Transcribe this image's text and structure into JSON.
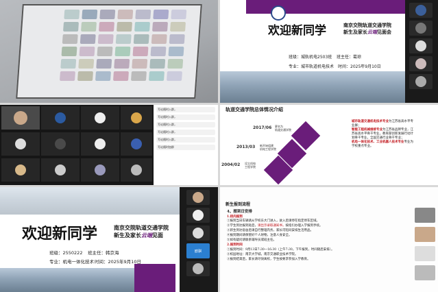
{
  "panel_slide": {
    "welcome": "欢迎新同学",
    "school_line1": "南京交院轨道交通学院",
    "school_line2_pre": "新生及家长",
    "school_line2_cloud": "云端",
    "school_line2_post": "见面会",
    "class_label": "班级：城轨机电2503班",
    "teacher_label": "班主任：葛琼",
    "major_label": "专业：城市轨道机电技术",
    "time_label": "时间：2025年9月10日"
  },
  "grid": {
    "names": [
      "欧骐",
      "欧骐",
      "欧骐",
      "欧骐",
      "老师",
      "学生",
      "家长"
    ],
    "chat": [
      "写论随时入群，",
      "写论随时入群，",
      "写论随时入群，",
      "写论随时入群，",
      "写论随时入群，",
      "写论随时加群"
    ]
  },
  "timeline": {
    "title": "轨道交通学院总体情况介绍",
    "years": [
      "2017/06",
      "2013/03",
      "2004/02"
    ],
    "boxes": [
      "更名为\n轨道交通学院",
      "新开始组建\n机电工程学院",
      "设立机电\n工程学院"
    ],
    "right_items": [
      "城市轨道交通机电技术专业",
      "智能工程机械维修专业",
      "机电一体化技术、工业机器人技术专业"
    ],
    "right_text": [
      "为江苏省高水平专业群；",
      "为江苏省品牌专业，江苏省高水平骨干专业，教育部创新发展行动计划骨干专业，全国交通行业骨干专业；",
      "专业为学校重点专业。"
    ]
  },
  "bottom_slide": {
    "welcome": "欢迎新同学",
    "school_line1": "南京交院轨道交通学院",
    "school_line2_pre": "新生及家长",
    "school_line2_cloud": "云端",
    "school_line2_post": "见面",
    "class_label": "班级：2550222",
    "teacher_label": "班主任：韩京海",
    "major_label": "专业：机电一体化技术",
    "time_label": "时间：2025年9月10日",
    "tile_label": "欧骐"
  },
  "doc": {
    "heading": "新生报到流程",
    "section": "4、报到日安排",
    "sub1": "1.校内报到",
    "line1": "①报到当日车辆请从学校东大门进入，驶入后请停在指定停车区域。",
    "line2_pre": "②学生到达报到处后，",
    "line2_red": "请出示录取通知书，",
    "line2_post": "按指引办理入学报到手续。",
    "line3": "③新生到达宿舍后请自行整理内务，家长可陪同安排生活用品。",
    "line4": "④报到期间请保管好个人财物，注意人身安全。",
    "line5": "⑤如有疑问请联系辅导员或班主任。",
    "sub2": "2.报到时间",
    "line6": "①报到时间：9月13日7:30—16:30（上午7:30，下午报到，时间随后安排）。",
    "line7": "②校园地址：南京大学城，南京交通职业技术学院。",
    "line8": "③报到结束后，家长请尽快离校，学生按要求参加入学教育。"
  },
  "colors": {
    "purple": "#6a1d7a",
    "red": "#c0141a"
  }
}
